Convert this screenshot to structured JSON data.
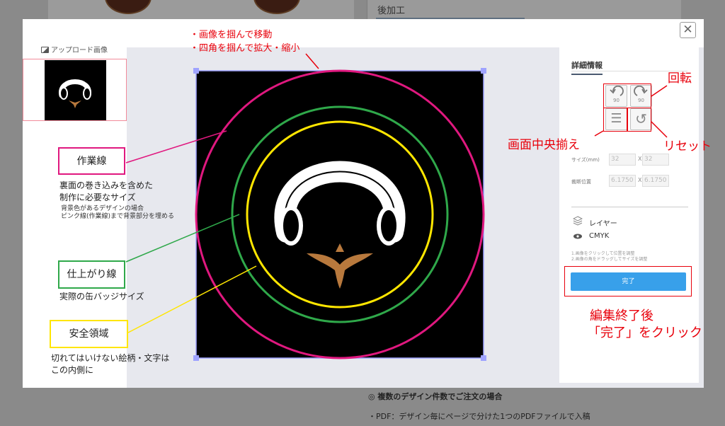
{
  "background": {
    "right_heading": "後加工",
    "bottom_heading": "◎ 複数のデザイン件数でご注文の場合",
    "bottom_text": "・PDF：デザイン毎にページで分けた1つのPDFファイルで入稿"
  },
  "modal": {
    "close_label": "✕",
    "upload_label": "アップロード画像",
    "panel": {
      "title": "詳細情報",
      "rotate_left_label": "90",
      "rotate_right_label": "90",
      "center_icon_glyph": "☰",
      "reset_icon_glyph": "↺",
      "size_label": "サイズ(mm)",
      "size_w": "32",
      "size_h": "32",
      "crop_label": "裁断位置",
      "crop_x": "6.1750",
      "crop_y": "6.1750",
      "x_sep": "X",
      "layer_label": "レイヤー",
      "color_mode": "CMYK",
      "note_1": "1.画像をクリックして位置を調整",
      "note_2": "2.画像の角をドラッグしてサイズを調整",
      "done_label": "完了"
    }
  },
  "annotations": {
    "top_1": "・画像を掴んで移動",
    "top_2": "・四角を掴んで拡大・縮小",
    "rotate": "回転",
    "center": "画面中央揃え",
    "reset": "リセット",
    "done_1": "編集終了後",
    "done_2": "「完了」をクリック",
    "work_line": {
      "title": "作業線",
      "desc_1": "裏面の巻き込みを含めた",
      "desc_2": "制作に必要なサイズ",
      "sub_1": "背景色があるデザインの場合",
      "sub_2": "ピンク線(作業線)まで背景部分を埋める"
    },
    "finish_line": {
      "title": "仕上がり線",
      "desc": "実際の缶バッジサイズ"
    },
    "safe_area": {
      "title": "安全領域",
      "desc_1": "切れてはいけない絵柄・文字は",
      "desc_2": "この内側に"
    }
  },
  "colors": {
    "work_line": "#e0187f",
    "finish_line": "#2fa84a",
    "safe_area": "#ffe600",
    "annotation_red": "#e8000b",
    "done_button": "#38a0ea",
    "logo_accent": "#b8793d"
  }
}
